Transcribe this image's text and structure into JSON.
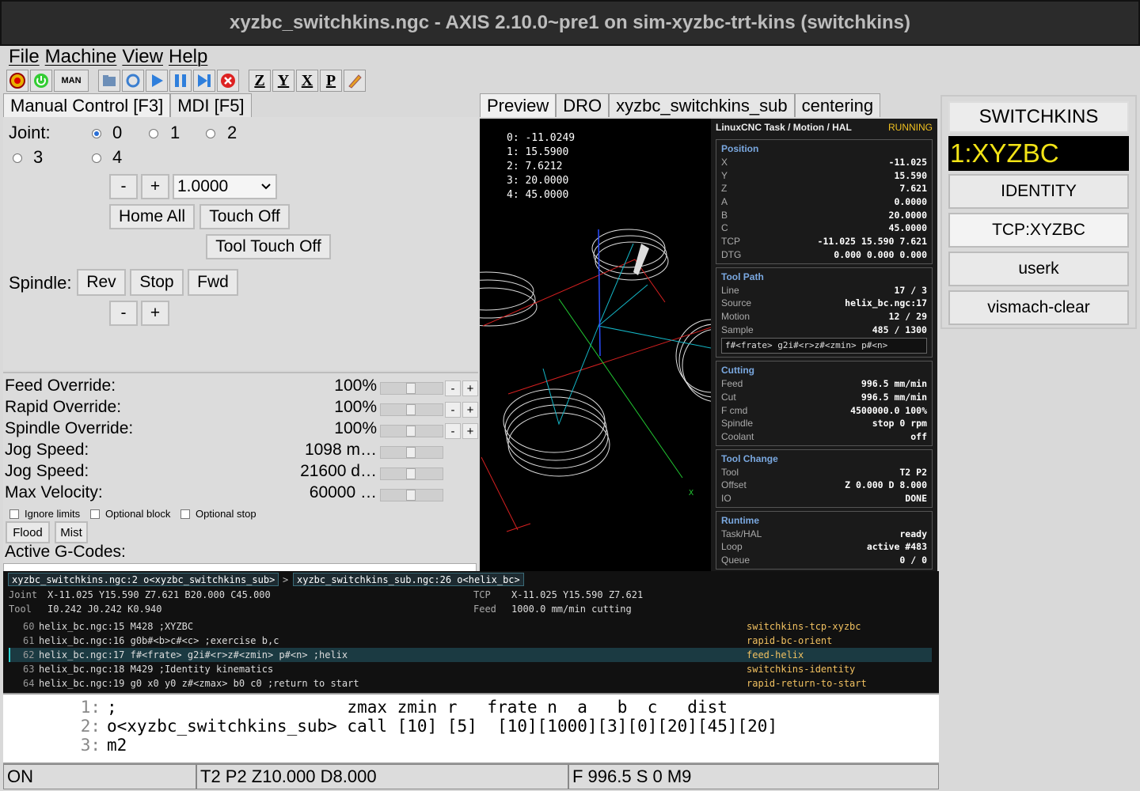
{
  "window": {
    "title": "xyzbc_switchkins.ngc - AXIS 2.10.0~pre1 on sim-xyzbc-trt-kins (switchkins)"
  },
  "menu": [
    "File",
    "Machine",
    "View",
    "Help"
  ],
  "toolbar": {
    "man_label": "MAN",
    "z": "Z",
    "y": "Y",
    "x": "X",
    "p": "P"
  },
  "left_tabs": [
    "Manual Control [F3]",
    "MDI [F5]"
  ],
  "manual": {
    "joint_label": "Joint:",
    "joints": [
      "0",
      "1",
      "2",
      "3",
      "4"
    ],
    "minus": "-",
    "plus": "+",
    "increment": "1.0000",
    "home_all": "Home All",
    "touch_off": "Touch Off",
    "tool_touch_off": "Tool Touch Off",
    "spindle_label": "Spindle:",
    "rev": "Rev",
    "stop": "Stop",
    "fwd": "Fwd"
  },
  "overrides": [
    {
      "name": "Feed Override:",
      "value": "100%"
    },
    {
      "name": "Rapid Override:",
      "value": "100%"
    },
    {
      "name": "Spindle Override:",
      "value": "100%"
    },
    {
      "name": "Jog Speed:",
      "value": "1098 m…"
    },
    {
      "name": "Jog Speed:",
      "value": "21600 d…"
    },
    {
      "name": "Max Velocity:",
      "value": "60000 …"
    }
  ],
  "options": {
    "ignore_limits": "Ignore limits",
    "optional_block": "Optional block",
    "optional_stop": "Optional stop",
    "flood": "Flood",
    "mist": "Mist",
    "active_gcodes": "Active G-Codes:"
  },
  "center_tabs": [
    "Preview",
    "DRO",
    "xyzbc_switchkins_sub",
    "centering"
  ],
  "preview_dro": [
    "0:   -11.0249",
    "1:   15.5900",
    "2:   7.6212",
    "3:   20.0000",
    "4:   45.0000"
  ],
  "hal_panel": {
    "title": "LinuxCNC Task / Motion / HAL",
    "state": "RUNNING",
    "position": {
      "title": "Position",
      "rows": [
        [
          "X",
          "-11.025"
        ],
        [
          "Y",
          "15.590"
        ],
        [
          "Z",
          "7.621"
        ],
        [
          "A",
          "0.0000"
        ],
        [
          "B",
          "20.0000"
        ],
        [
          "C",
          "45.0000"
        ],
        [
          "TCP",
          "-11.025 15.590 7.621"
        ],
        [
          "DTG",
          "0.000 0.000 0.000"
        ]
      ]
    },
    "toolpath": {
      "title": "Tool Path",
      "rows": [
        [
          "Line",
          "17 / 3"
        ],
        [
          "Source",
          "helix_bc.ngc:17"
        ],
        [
          "Motion",
          "12 / 29"
        ],
        [
          "Sample",
          "485 / 1300"
        ]
      ],
      "code": "f#<frate> g2i#<r>z#<zmin> p#<n>"
    },
    "cutting": {
      "title": "Cutting",
      "rows": [
        [
          "Feed",
          "996.5 mm/min"
        ],
        [
          "Cut",
          "996.5 mm/min"
        ],
        [
          "F cmd",
          "4500000.0 100%"
        ],
        [
          "Spindle",
          "stop 0 rpm"
        ],
        [
          "Coolant",
          "off"
        ]
      ]
    },
    "toolchange": {
      "title": "Tool Change",
      "rows": [
        [
          "Tool",
          "T2 P2"
        ],
        [
          "Offset",
          "Z 0.000 D 8.000"
        ],
        [
          "IO",
          "DONE"
        ]
      ]
    },
    "runtime": {
      "title": "Runtime",
      "rows": [
        [
          "Task/HAL",
          "ready"
        ],
        [
          "Loop",
          "active #483"
        ],
        [
          "Queue",
          "0 / 0"
        ]
      ]
    }
  },
  "right_panel": {
    "switchkins": "SWITCHKINS",
    "mode": "1:XYZBC",
    "identity": "IDENTITY",
    "tcp": "TCP:XYZBC",
    "userk": "userk",
    "vismach": "vismach-clear"
  },
  "strip": {
    "crumb1": "xyzbc_switchkins.ngc:2 o<xyzbc_switchkins_sub>",
    "sep": ">",
    "crumb2": "xyzbc_switchkins_sub.ngc:26 o<helix_bc>",
    "joint_label": "Joint",
    "joint_val": "X-11.025 Y15.590 Z7.621 B20.000 C45.000",
    "tcp_label": "TCP",
    "tcp_val": "X-11.025 Y15.590 Z7.621",
    "tool_label": "Tool",
    "tool_val": "I0.242 J0.242 K0.940",
    "feed_label": "Feed",
    "feed_val": "1000.0 mm/min cutting",
    "lines": [
      {
        "n": "60",
        "code": "helix_bc.ngc:15 M428 ;XYZBC",
        "tag": "switchkins-tcp-xyzbc"
      },
      {
        "n": "61",
        "code": "helix_bc.ngc:16 g0b#<b>c#<c> ;exercise b,c",
        "tag": "rapid-bc-orient"
      },
      {
        "n": "62",
        "code": "helix_bc.ngc:17 f#<frate> g2i#<r>z#<zmin> p#<n> ;helix",
        "tag": "feed-helix"
      },
      {
        "n": "63",
        "code": "helix_bc.ngc:18 M429 ;Identity kinematics",
        "tag": "switchkins-identity"
      },
      {
        "n": "64",
        "code": "helix_bc.ngc:19 g0 x0 y0 z#<zmax> b0 c0 ;return to start",
        "tag": "rapid-return-to-start"
      }
    ]
  },
  "editor": [
    {
      "n": "1:",
      "text": ";                       zmax zmin r   frate n  a   b  c   dist"
    },
    {
      "n": "2:",
      "text": "o<xyzbc_switchkins_sub> call [10] [5]  [10][1000][3][0][20][45][20]"
    },
    {
      "n": "3:",
      "text": "m2"
    }
  ],
  "statusbar": {
    "state": "ON",
    "tool": "T2 P2 Z10.000 D8.000",
    "feed": "F 996.5 S 0 M9"
  }
}
